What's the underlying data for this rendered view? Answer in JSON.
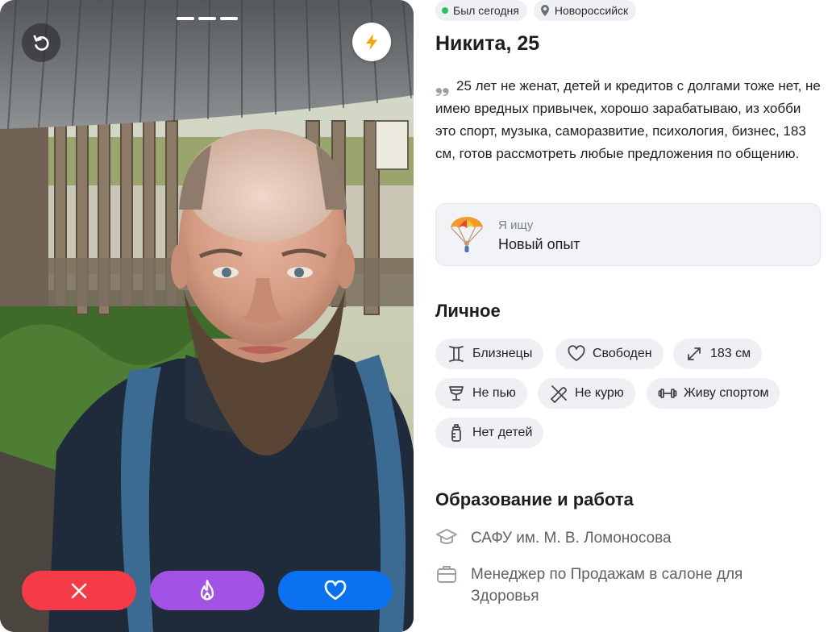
{
  "app": {
    "accent_like": "#0a72f0",
    "accent_dislike": "#f53a48",
    "accent_super": "#a352e6",
    "online_color": "#2bc25a"
  },
  "photo": {
    "pager_count": 3,
    "undo_icon": "undo-icon",
    "boost_icon": "lightning-icon"
  },
  "actions": {
    "dislike_icon": "close-icon",
    "super_icon": "flame-icon",
    "like_icon": "heart-icon"
  },
  "status": {
    "online": "Был сегодня",
    "city": "Новороссийск"
  },
  "profile": {
    "name_age": "Никита, 25",
    "bio": "25 лет не женат, детей и кредитов с долгами тоже нет, не имею вредных привычек, хорошо зарабатываю, из хобби это спорт, музыка, саморазвитие, психология, бизнес, 183 см, готов рассмотреть любые предложения по общению."
  },
  "looking_for": {
    "label": "Я ищу",
    "value": "Новый опыт",
    "icon": "parachute-icon"
  },
  "personal": {
    "title": "Личное",
    "tags": [
      {
        "label": "Близнецы",
        "icon": "gemini-icon"
      },
      {
        "label": "Свободен",
        "icon": "heart-outline-icon"
      },
      {
        "label": "183 см",
        "icon": "height-arrows-icon"
      },
      {
        "label": "Не пью",
        "icon": "glass-icon"
      },
      {
        "label": "Не курю",
        "icon": "no-smoking-icon"
      },
      {
        "label": "Живу спортом",
        "icon": "dumbbell-icon"
      },
      {
        "label": "Нет детей",
        "icon": "baby-bottle-icon"
      }
    ]
  },
  "education": {
    "title": "Образование и работа",
    "school": "САФУ им. М. В. Ломоносова",
    "job": "Менеджер по Продажам в салоне для Здоровья"
  }
}
